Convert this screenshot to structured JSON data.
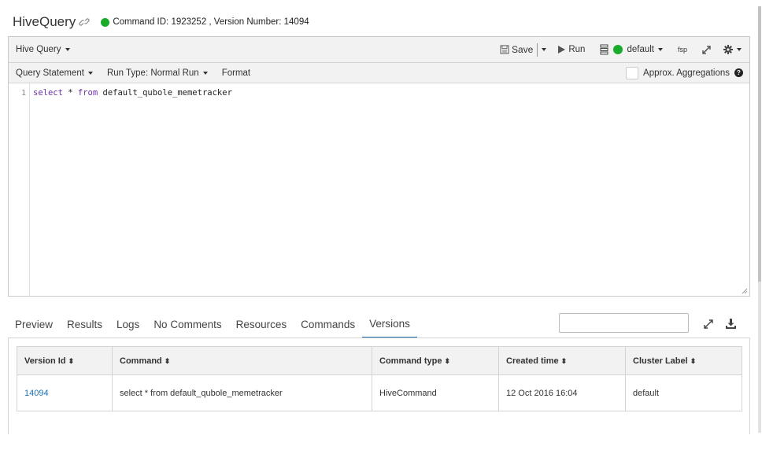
{
  "header": {
    "title": "HiveQuery",
    "command_info": "Command ID: 1923252 , Version Number: 14094"
  },
  "toolbar": {
    "query_type": "Hive Query",
    "save_label": "Save",
    "run_label": "Run",
    "cluster_label": "default",
    "fsp_label": "fsp"
  },
  "subbar": {
    "query_statement": "Query Statement",
    "run_type": "Run Type: Normal Run",
    "format": "Format",
    "approx_label": "Approx. Aggregations",
    "help_glyph": "?"
  },
  "editor": {
    "line_number": "1",
    "kw_select": "select",
    "star": " * ",
    "kw_from": "from",
    "table": " default_qubole_memetracker"
  },
  "tabs": [
    "Preview",
    "Results",
    "Logs",
    "No Comments",
    "Resources",
    "Commands",
    "Versions"
  ],
  "active_tab": "Versions",
  "search": {
    "placeholder": ""
  },
  "versions_table": {
    "headers": [
      "Version Id",
      "Command",
      "Command type",
      "Created time",
      "Cluster Label"
    ],
    "rows": [
      [
        "14094",
        "select * from default_qubole_memetracker",
        "HiveCommand",
        "12 Oct 2016 16:04",
        "default"
      ]
    ]
  },
  "colors": {
    "status_green": "#1aab2b",
    "link_blue": "#1f6fb5",
    "keyword_purple": "#6b2fa8"
  }
}
